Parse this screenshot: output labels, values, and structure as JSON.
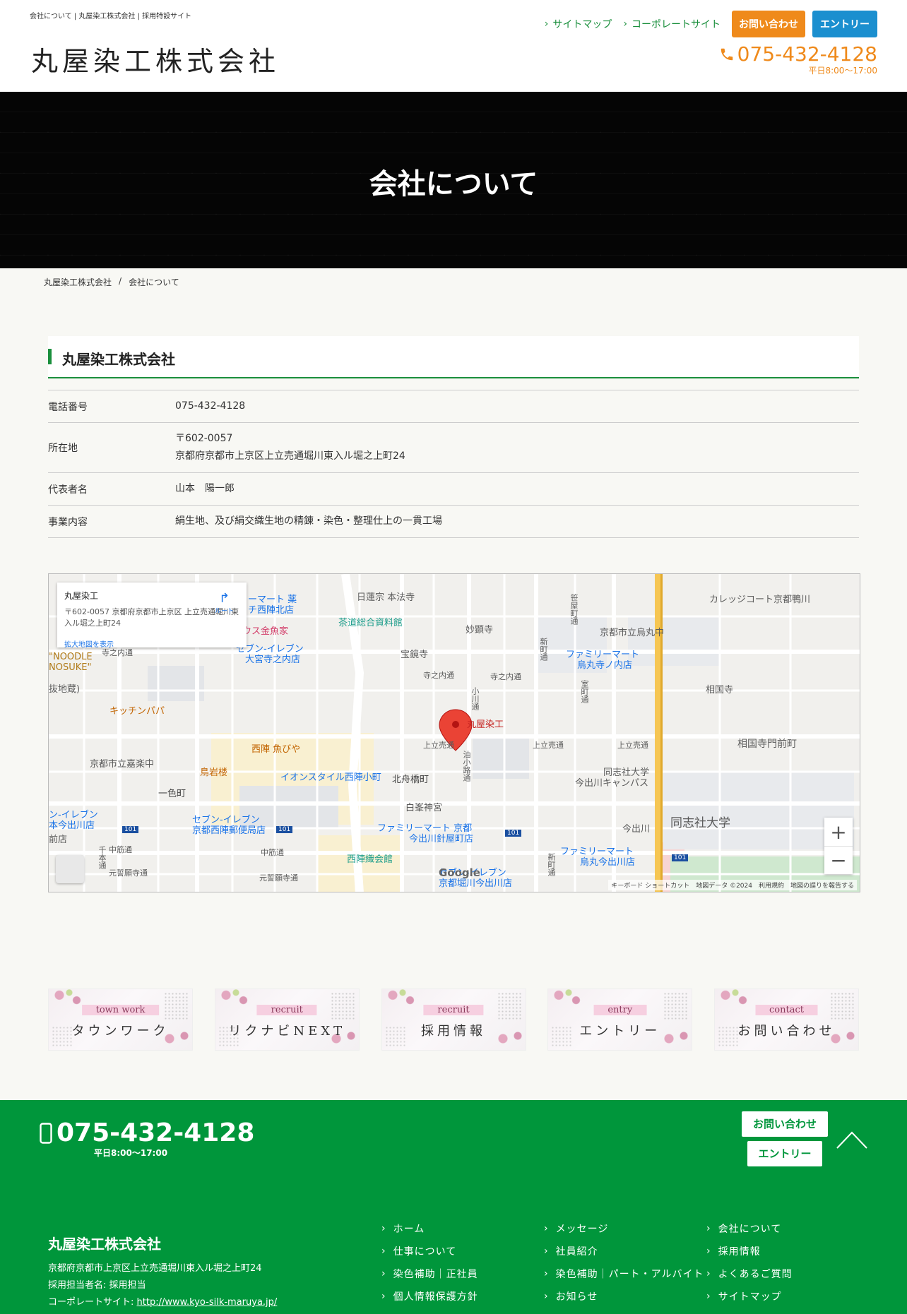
{
  "header": {
    "tagline": "会社について | 丸屋染工株式会社 | 採用特設サイト",
    "logo": "丸屋染工株式会社",
    "nav": [
      {
        "label": "サイトマップ"
      },
      {
        "label": "コーポレートサイト"
      }
    ],
    "contact_button": "お問い合わせ",
    "entry_button": "エントリー",
    "phone": "075-432-4128",
    "hours": "平日8:00〜17:00",
    "colors": {
      "accent_green": "#1a8f3c",
      "accent_orange": "#ef8a1b",
      "accent_blue": "#1b8fcf"
    }
  },
  "hero": {
    "title": "会社について"
  },
  "breadcrumb": {
    "home": "丸屋染工株式会社",
    "separator": "/",
    "current": "会社について"
  },
  "company": {
    "heading": "丸屋染工株式会社",
    "rows": [
      {
        "label": "電話番号",
        "value": "075-432-4128",
        "value2": ""
      },
      {
        "label": "所在地",
        "value": "〒602-0057",
        "value2": "京都府京都市上京区上立売通堀川東入ル堀之上町24"
      },
      {
        "label": "代表者名",
        "value": "山本　陽一郎",
        "value2": ""
      },
      {
        "label": "事業内容",
        "value": "絹生地、及び絹交織生地の精錬・染色・整理仕上の一貫工場",
        "value2": ""
      }
    ]
  },
  "map": {
    "card_name": "丸屋染工",
    "card_address": "〒602-0057 京都府京都市上京区 上立売通堀川東入ル堀之上町24",
    "card_larger_map": "拡大地図を表示",
    "card_directions": "ルート",
    "marker_label": "丸屋染工",
    "zoom_in": "+",
    "zoom_out": "−",
    "google": "Google",
    "attribution": "キーボード ショートカット　地図データ ©2024　利用規約　地図の誤りを報告する",
    "labels": {
      "nichirenshu": "日蓮宗 本法寺",
      "sado": "茶道総合資料館",
      "myokenji": "妙顕寺",
      "hokeiji": "宝鏡寺",
      "teranouchi1": "寺之内通",
      "teranouchi2": "寺之内通",
      "teranouchi3": "寺之内通",
      "ogawa": "小川通",
      "kamidachiuri1": "上立売通",
      "kamidachiuri2": "上立売通",
      "kamidachiuri3": "上立売通",
      "kyoto_karasuma": "京都市立烏丸中",
      "familymart1": "ファミリーマート",
      "familymart1b": "烏丸寺ノ内店",
      "shokokuji": "相国寺",
      "shokokuji_monzen": "相国寺門前町",
      "college_court": "カレッジコート京都鴨川",
      "doshisha_imadegawa": "同志社大学",
      "doshisha_imadegawa2": "今出川キャンパス",
      "doshisha": "同志社大学",
      "imadegawa": "今出川",
      "kitchen_papa": "キッチンパパ",
      "nishijin": "西陣 魚びや",
      "torii": "鳥岩楼",
      "aeon": "イオンスタイル西陣小町",
      "kitafunabashi": "北舟橋町",
      "shiramine": "白峯神宮",
      "familymart2": "ファミリーマート 京都",
      "familymart2b": "今出川針屋町店",
      "seven1": "セブン-イレブン",
      "seven1b": "京都西陣郵便局店",
      "seven2": "セブン-イレブン",
      "seven2b": "大宮寺之内店",
      "nishijin_ori": "西陣織会館",
      "seven3": "セブン-イレブン",
      "seven3b": "京都堀川今出川店",
      "familymart3": "ファミリーマート",
      "familymart3b": "烏丸今出川店",
      "rakuchu": "京都市立嘉楽中",
      "isshiki": "一色町",
      "nakasuji1": "中筋通",
      "nakasuji2": "中筋通",
      "motoseiganji1": "元誓願寺通",
      "motoseiganji2": "元誓願寺通",
      "kinuyo": "ウス金魚家",
      "mart_top": "ーマート 薬",
      "mart_top2": "チ西陣北店",
      "noodle": "\"NOODLE",
      "noodle2": "NOSUKE\"",
      "fujimori": "抜地蔵)",
      "seven_left": "ン-イレブン",
      "seven_left2": "本今出川店",
      "mae": "前店",
      "route101": "101",
      "sasaya": "笹屋町通",
      "shinmachi": "新町通",
      "muromachi": "室町通",
      "aburakoji": "油小路通",
      "shinmachi2": "新町通",
      "chiyofune": "千本通"
    }
  },
  "banners": [
    {
      "en": "town work",
      "jp": "タウンワーク"
    },
    {
      "en": "recruit",
      "jp": "リクナビNEXT"
    },
    {
      "en": "recruit",
      "jp": "採用情報"
    },
    {
      "en": "entry",
      "jp": "エントリー"
    },
    {
      "en": "contact",
      "jp": "お問い合わせ"
    }
  ],
  "footer": {
    "phone": "075-432-4128",
    "hours": "平日8:00〜17:00",
    "contact_button": "お問い合わせ",
    "entry_button": "エントリー",
    "company_name": "丸屋染工株式会社",
    "address": "京都府京都市上京区上立売通堀川東入ル堀之上町24",
    "recruiter": "採用担当者名: 採用担当",
    "corporate_label": "コーポレートサイト: ",
    "corporate_url": "http://www.kyo-silk-maruya.jp/",
    "nav": [
      {
        "label": "ホーム"
      },
      {
        "label": "メッセージ"
      },
      {
        "label": "会社について"
      },
      {
        "label": "仕事について"
      },
      {
        "label": "社員紹介"
      },
      {
        "label": "採用情報"
      },
      {
        "label": "染色補助｜正社員"
      },
      {
        "label": "染色補助｜パート・アルバイト"
      },
      {
        "label": "よくあるご質問"
      },
      {
        "label": "個人情報保護方針"
      },
      {
        "label": "お知らせ"
      },
      {
        "label": "サイトマップ"
      }
    ],
    "color": "#00963b"
  }
}
